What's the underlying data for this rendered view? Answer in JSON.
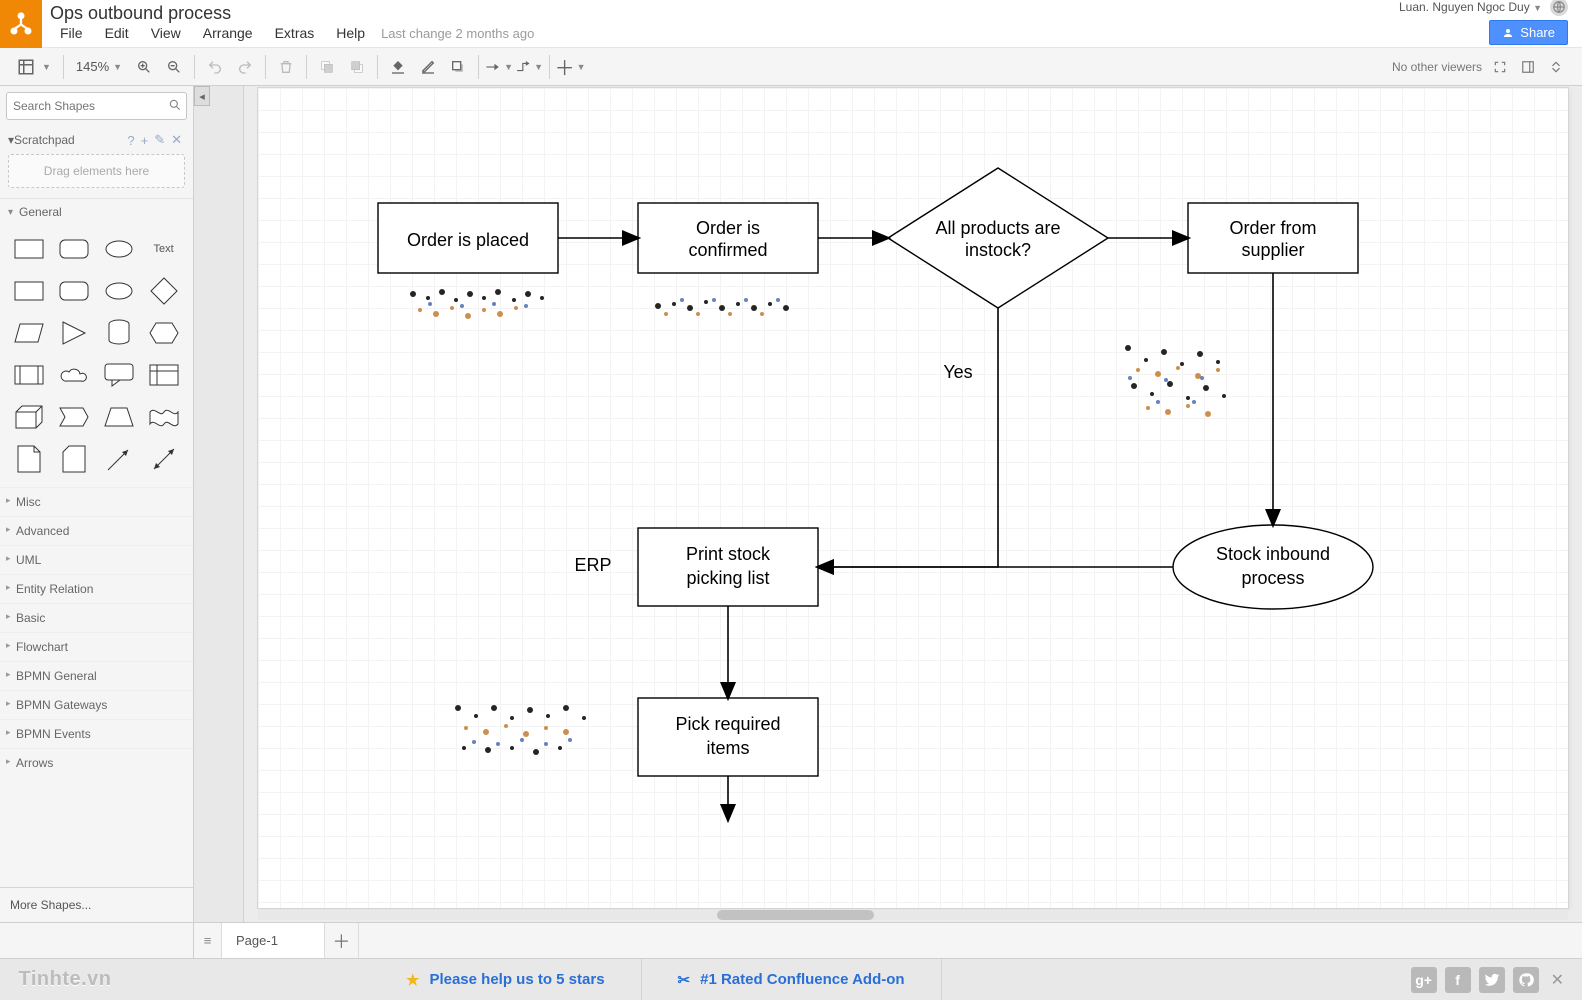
{
  "header": {
    "doc_title": "Ops outbound process",
    "user_name": "Luan. Nguyen Ngoc Duy",
    "menu": [
      "File",
      "Edit",
      "View",
      "Arrange",
      "Extras",
      "Help"
    ],
    "last_change": "Last change 2 months ago",
    "share_label": "Share"
  },
  "toolbar": {
    "zoom": "145%",
    "no_viewers": "No other viewers"
  },
  "sidebar": {
    "search_placeholder": "Search Shapes",
    "scratchpad_title": "Scratchpad",
    "scratchpad_drop": "Drag elements here",
    "general_title": "General",
    "text_label": "Text",
    "categories": [
      "Misc",
      "Advanced",
      "UML",
      "Entity Relation",
      "Basic",
      "Flowchart",
      "BPMN General",
      "BPMN Gateways",
      "BPMN Events",
      "Arrows"
    ],
    "more_shapes": "More Shapes..."
  },
  "pager": {
    "page_label": "Page-1"
  },
  "footer": {
    "brand": "Tinhte.vn",
    "help_label": "Please help us to 5 stars",
    "addon_label": "#1 Rated Confluence Add-on"
  },
  "diagram": {
    "nodes": {
      "order_placed": "Order is placed",
      "order_confirmed_l1": "Order is",
      "order_confirmed_l2": "confirmed",
      "instock_l1": "All products are",
      "instock_l2": "instock?",
      "order_supplier_l1": "Order from",
      "order_supplier_l2": "supplier",
      "print_list_l1": "Print stock",
      "print_list_l2": "picking list",
      "stock_inbound_l1": "Stock inbound",
      "stock_inbound_l2": "process",
      "pick_items_l1": "Pick required",
      "pick_items_l2": "items"
    },
    "labels": {
      "yes": "Yes",
      "erp": "ERP"
    }
  },
  "chart_data": {
    "type": "flowchart",
    "nodes": [
      {
        "id": "n1",
        "shape": "process",
        "text": "Order is placed"
      },
      {
        "id": "n2",
        "shape": "process",
        "text": "Order is confirmed"
      },
      {
        "id": "n3",
        "shape": "decision",
        "text": "All products are instock?"
      },
      {
        "id": "n4",
        "shape": "process",
        "text": "Order from supplier"
      },
      {
        "id": "n5",
        "shape": "process",
        "text": "Print stock picking list"
      },
      {
        "id": "n6",
        "shape": "terminator",
        "text": "Stock inbound process"
      },
      {
        "id": "n7",
        "shape": "process",
        "text": "Pick required items"
      }
    ],
    "edges": [
      {
        "from": "n1",
        "to": "n2"
      },
      {
        "from": "n2",
        "to": "n3"
      },
      {
        "from": "n3",
        "to": "n4"
      },
      {
        "from": "n3",
        "to": "n5",
        "label": "Yes"
      },
      {
        "from": "n4",
        "to": "n6"
      },
      {
        "from": "n6",
        "to": "n5"
      },
      {
        "from": "n5",
        "to": "n7"
      }
    ],
    "annotations": [
      {
        "near": "n5",
        "text": "ERP"
      }
    ]
  }
}
